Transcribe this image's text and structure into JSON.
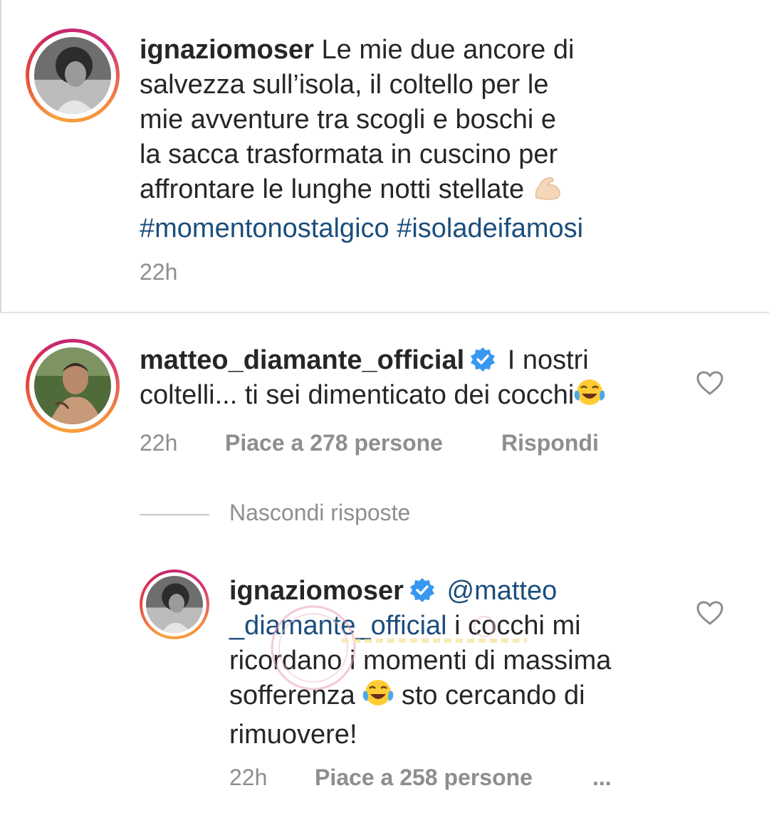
{
  "caption": {
    "username": "ignaziomoser",
    "lines": [
      "Le mie due ancore di",
      "salvezza sull’isola, il coltello per le",
      "mie avventure tra scogli e boschi e",
      "la sacca trasformata in cuscino per",
      "affrontare le lunghe notti stellate"
    ],
    "emoji": "flexed-biceps-emoji",
    "hashtags": "#momentonostalgico #isoladeifamosi",
    "time": "22h"
  },
  "comment": {
    "username": "matteo_diamante_official",
    "verified": true,
    "text_line1": "I nostri",
    "text_line2": "coltelli... ti sei dimenticato dei cocchi",
    "emoji": "tears-of-joy-emoji",
    "time": "22h",
    "likes": "Piace a 278 persone",
    "reply_label": "Rispondi"
  },
  "hide_replies_label": "Nascondi risposte",
  "reply": {
    "username": "ignaziomoser",
    "verified": true,
    "mention_part1": "@matteo",
    "mention_part2": "_diamante_official",
    "text_after_mention": " i cocchi mi",
    "line3": "ricordano i momenti di massima",
    "line4a": "sofferenza ",
    "line4b": " sto cercando di",
    "line5": "rimuovere!",
    "time": "22h",
    "likes": "Piace a 258 persone",
    "more": "..."
  },
  "colors": {
    "text": "#262626",
    "secondary": "#8e8e8e",
    "link": "#1b4e7c",
    "verified": "#3897f0"
  }
}
